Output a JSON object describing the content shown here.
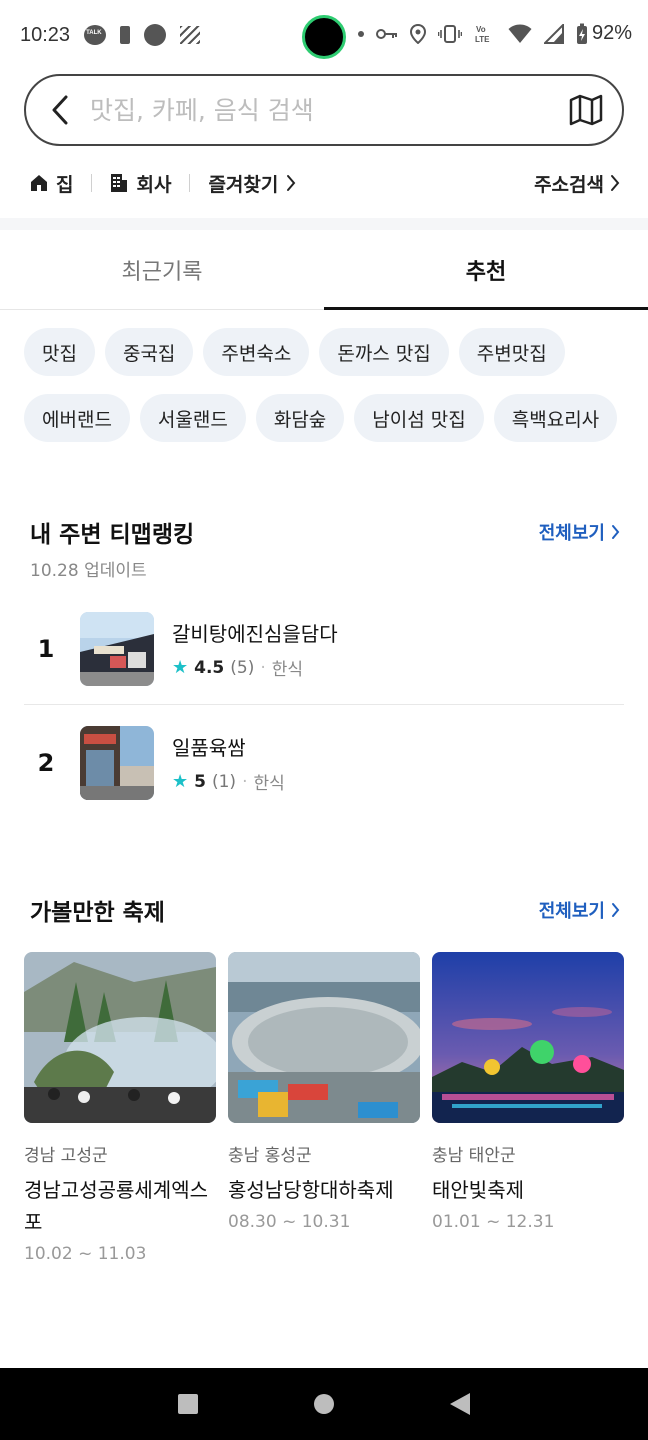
{
  "status_bar": {
    "time": "10:23",
    "battery_percent": "92%"
  },
  "search": {
    "placeholder": "맛집, 카페, 음식 검색"
  },
  "quick_links": {
    "home": "집",
    "work": "회사",
    "favorites": "즐겨찾기",
    "address_search": "주소검색"
  },
  "tabs": [
    {
      "label": "최근기록",
      "active": false
    },
    {
      "label": "추천",
      "active": true
    }
  ],
  "chips_row1": [
    "맛집",
    "중국집",
    "주변숙소",
    "돈까스 맛집",
    "주변맛집"
  ],
  "chips_row2": [
    "에버랜드",
    "서울랜드",
    "화담숲",
    "남이섬 맛집",
    "흑백요리사"
  ],
  "ranking": {
    "title": "내 주변 티맵랭킹",
    "see_all": "전체보기",
    "updated": "10.28 업데이트",
    "items": [
      {
        "rank": "1",
        "name": "갈비탕에진심을담다",
        "rating": "4.5",
        "count": "(5)",
        "category": "한식"
      },
      {
        "rank": "2",
        "name": "일품육쌈",
        "rating": "5",
        "count": "(1)",
        "category": "한식"
      }
    ]
  },
  "festivals": {
    "title": "가볼만한 축제",
    "see_all": "전체보기",
    "items": [
      {
        "region": "경남 고성군",
        "name": "경남고성공룡세계엑스포",
        "dates": "10.02 ~ 11.03"
      },
      {
        "region": "충남 홍성군",
        "name": "홍성남당항대하축제",
        "dates": "08.30 ~ 10.31"
      },
      {
        "region": "충남 태안군",
        "name": "태안빛축제",
        "dates": "01.01 ~ 12.31"
      }
    ]
  },
  "colors": {
    "accent": "#1f5fbf",
    "star": "#1cc0c8",
    "chip_bg": "#eef2f7"
  }
}
